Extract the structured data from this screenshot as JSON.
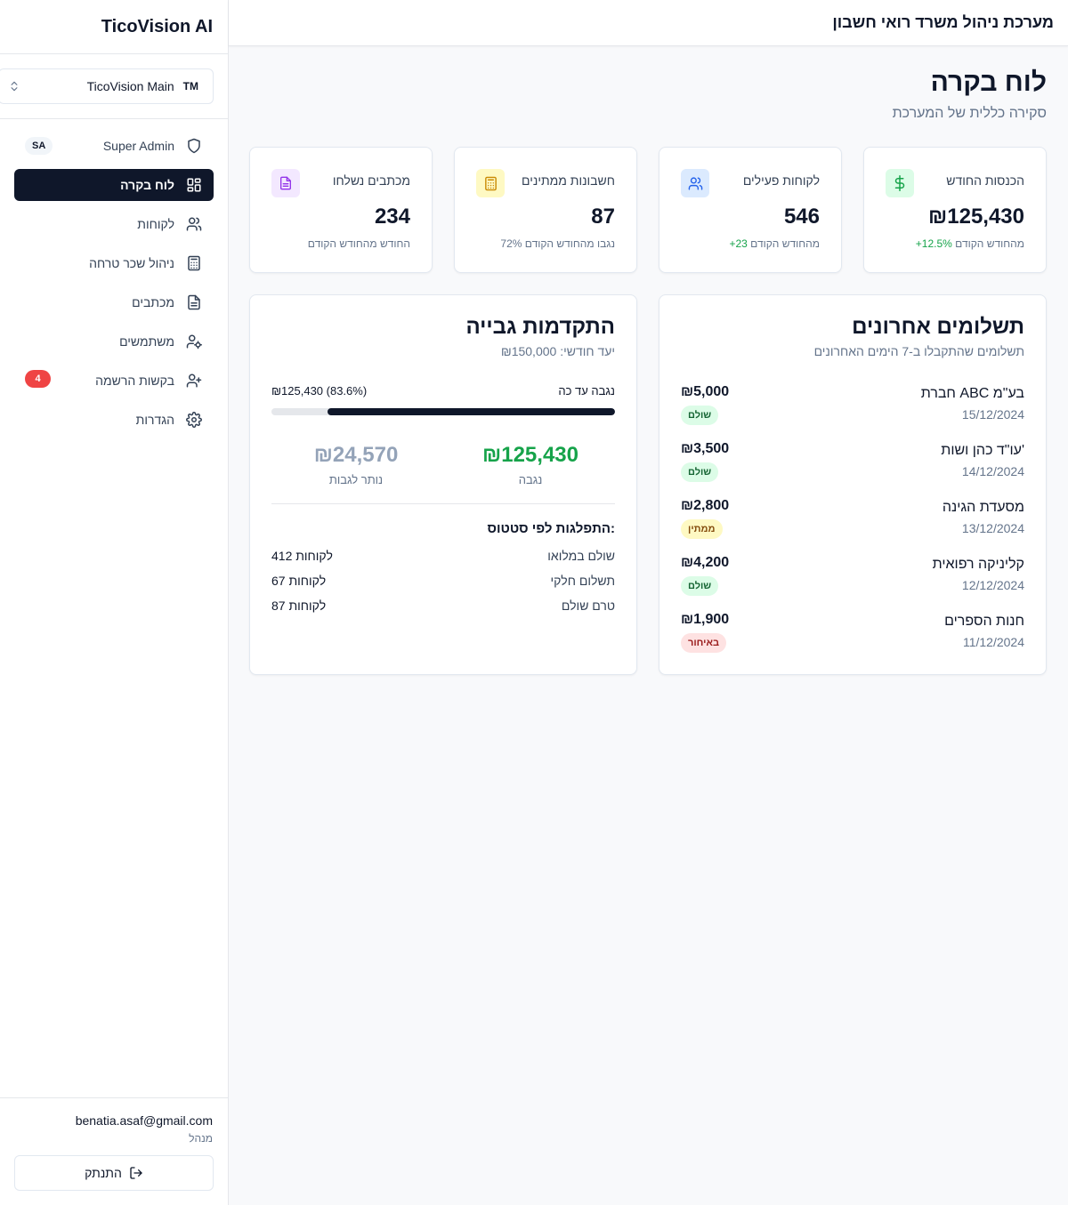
{
  "sidebar": {
    "brand": "TicoVision AI",
    "org": {
      "name": "TicoVision Main",
      "initials": "TM"
    },
    "nav": [
      {
        "label": "Super Admin",
        "tag": "SA"
      },
      {
        "label": "לוח בקרה"
      },
      {
        "label": "לקוחות"
      },
      {
        "label": "ניהול שכר טרחה"
      },
      {
        "label": "מכתבים"
      },
      {
        "label": "משתמשים"
      },
      {
        "label": "בקשות הרשמה",
        "count": "4"
      },
      {
        "label": "הגדרות"
      }
    ],
    "user": {
      "email": "benatia.asaf@gmail.com",
      "role": "מנהל"
    },
    "logout_label": "התנתק"
  },
  "header": {
    "title": "מערכת ניהול משרד רואי חשבון"
  },
  "page": {
    "title": "לוח בקרה",
    "subtitle": "סקירה כללית של המערכת"
  },
  "stats": [
    {
      "label": "הכנסות החודש",
      "value": "₪125,430",
      "delta": "+12.5%",
      "note": "מהחודש הקודם",
      "icon": "dollar-icon",
      "color": "#16a34a",
      "bg": "#dcfce7"
    },
    {
      "label": "לקוחות פעילים",
      "value": "546",
      "delta": "+23",
      "note": "מהחודש הקודם",
      "icon": "users-icon",
      "color": "#2563eb",
      "bg": "#dbeafe"
    },
    {
      "label": "חשבונות ממתינים",
      "value": "87",
      "note": "72% נגבו מהחודש הקודם",
      "icon": "calculator-icon",
      "color": "#ca8a04",
      "bg": "#fef9c3"
    },
    {
      "label": "מכתבים נשלחו",
      "value": "234",
      "note": "החודש מהחודש הקודם",
      "icon": "file-icon",
      "color": "#9333ea",
      "bg": "#f3e8ff"
    }
  ],
  "payments": {
    "title": "תשלומים אחרונים",
    "subtitle": "תשלומים שהתקבלו ב-7 הימים האחרונים",
    "rows": [
      {
        "name": "חברת ABC בע\"מ",
        "date": "15/12/2024",
        "amount": "₪5,000",
        "status": "שולם",
        "kind": "paid"
      },
      {
        "name": "עו\"ד כהן ושות'",
        "date": "14/12/2024",
        "amount": "₪3,500",
        "status": "שולם",
        "kind": "paid"
      },
      {
        "name": "מסעדת הגינה",
        "date": "13/12/2024",
        "amount": "₪2,800",
        "status": "ממתין",
        "kind": "pending"
      },
      {
        "name": "קליניקה רפואית",
        "date": "12/12/2024",
        "amount": "₪4,200",
        "status": "שולם",
        "kind": "paid"
      },
      {
        "name": "חנות הספרים",
        "date": "11/12/2024",
        "amount": "₪1,900",
        "status": "באיחור",
        "kind": "late"
      }
    ]
  },
  "collection": {
    "title": "התקדמות גבייה",
    "subtitle": "יעד חודשי: ₪150,000",
    "progress_label": "נגבה עד כה",
    "progress_value": "₪125,430 (83.6%)",
    "progress": 0.836,
    "collected": "₪125,430",
    "collected_label": "נגבה",
    "remaining": "₪24,570",
    "remaining_label": "נותר לגבות",
    "dist_title": "התפלגות לפי סטטוס:",
    "dist": [
      {
        "label": "שולם במלואו",
        "value": "412 לקוחות"
      },
      {
        "label": "תשלום חלקי",
        "value": "67 לקוחות"
      },
      {
        "label": "טרם שולם",
        "value": "87 לקוחות"
      }
    ]
  },
  "colors": {
    "primary": "#0f172a",
    "success": "#16a34a",
    "danger": "#ef4444"
  }
}
